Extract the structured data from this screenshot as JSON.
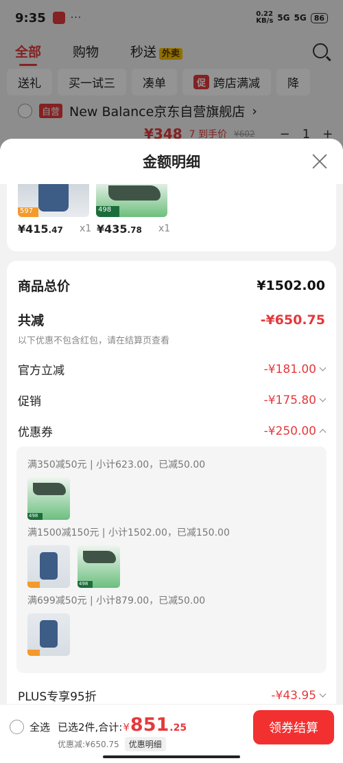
{
  "status": {
    "time": "9:35",
    "dots": "···",
    "net_top": "0.22",
    "net_bottom": "KB/s",
    "signal1": "5G",
    "signal2": "5G",
    "battery": "86"
  },
  "tabs": [
    {
      "label": "全部"
    },
    {
      "label": "购物"
    },
    {
      "label": "秒送"
    }
  ],
  "waimai": "外卖",
  "chips": [
    "送礼",
    "买一试三",
    "凑单",
    "跨店满减",
    "降"
  ],
  "cu_badge": "促",
  "shop": {
    "badge": "自营",
    "name": "New Balance京东自营旗舰店",
    "arrow": "›"
  },
  "bg_price": {
    "price": "¥348",
    "label": "7 到手价",
    "original": "¥602",
    "qty": "1",
    "minus": "−",
    "plus": "+"
  },
  "sheet": {
    "title": "金额明细"
  },
  "items": [
    {
      "tag": "597",
      "price_int": "¥415",
      "price_dec": ".47",
      "qty": "x1"
    },
    {
      "tag": "498",
      "price_int": "¥435",
      "price_dec": ".78",
      "qty": "x1"
    }
  ],
  "detail": {
    "total_label": "商品总价",
    "total_value": "¥1502.00",
    "discount_label": "共减",
    "discount_value": "-¥650.75",
    "note": "以下优惠不包含红包，请在结算页查看",
    "official_label": "官方立减",
    "official_value": "-¥181.00",
    "promo_label": "促销",
    "promo_value": "-¥175.80",
    "coupon_label": "优惠券",
    "coupon_value": "-¥250.00",
    "plus_label": "PLUS专享95折",
    "plus_value": "-¥43.95"
  },
  "coupons": [
    {
      "text": "满350减50元 | 小计623.00，已减50.00",
      "tag": "498"
    },
    {
      "text": "满1500减150元 | 小计1502.00，已减150.00",
      "tag": "498"
    },
    {
      "text": "满699减50元 | 小计879.00，已减50.00"
    }
  ],
  "bottom": {
    "select_all": "全选",
    "selected_text": "已选2件,合计:",
    "currency": "¥",
    "total_int": "851",
    "total_dec": ".25",
    "saved": "优惠减:¥650.75",
    "detail_btn": "优惠明细",
    "checkout": "领券结算"
  },
  "colors": {
    "accent": "#e4393c",
    "checkout": "#f23030"
  }
}
